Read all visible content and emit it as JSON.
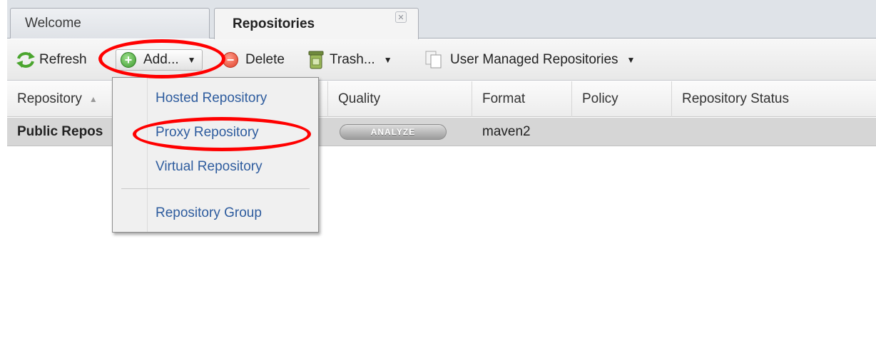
{
  "tabs": {
    "welcome_label": "Welcome",
    "repositories_label": "Repositories",
    "close_glyph": "✕"
  },
  "toolbar": {
    "refresh_label": "Refresh",
    "add_label": "Add...",
    "delete_label": "Delete",
    "trash_label": "Trash...",
    "user_managed_label": "User Managed Repositories"
  },
  "grid": {
    "columns": {
      "repository": "Repository",
      "quality": "Quality",
      "format": "Format",
      "policy": "Policy",
      "status": "Repository Status"
    },
    "rows": [
      {
        "name": "Public Repos",
        "quality_button": "ANALYZE",
        "format": "maven2"
      }
    ]
  },
  "add_menu": {
    "items": [
      "Hosted Repository",
      "Proxy Repository",
      "Virtual Repository",
      "Repository Group"
    ]
  },
  "colors": {
    "annotation": "#ff0000",
    "menu_link": "#2e5c9e",
    "selected_row": "#d6d6d6"
  }
}
